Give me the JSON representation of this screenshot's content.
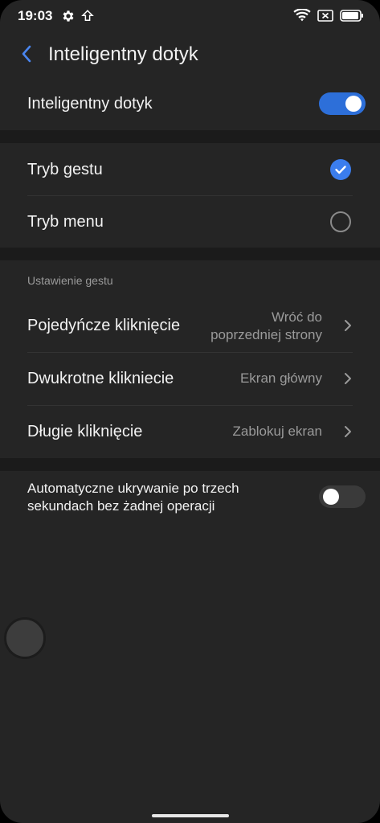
{
  "status_bar": {
    "time": "19:03",
    "icons": [
      "gear-icon",
      "upload-arrow-icon",
      "wifi-icon",
      "no-sim-icon",
      "battery-icon"
    ],
    "battery_level": 0.9
  },
  "header": {
    "back_icon": "chevron-left-icon",
    "title": "Inteligentny dotyk"
  },
  "main_toggle": {
    "label": "Inteligentny dotyk",
    "state": "on"
  },
  "mode": {
    "options": [
      {
        "label": "Tryb gestu",
        "selected": true
      },
      {
        "label": "Tryb menu",
        "selected": false
      }
    ]
  },
  "gesture_settings": {
    "header": "Ustawienie gestu",
    "items": [
      {
        "label": "Pojedyńcze kliknięcie",
        "value_line1": "Wróć do",
        "value_line2": "poprzedniej strony"
      },
      {
        "label": "Dwukrotne klikniecie",
        "value": "Ekran główny"
      },
      {
        "label": "Długie kliknięcie",
        "value": "Zablokuj ekran"
      }
    ]
  },
  "auto_hide": {
    "label_line1": "Automatyczne ukrywanie po trzech",
    "label_line2": "sekundach bez żadnej operacji",
    "state": "off"
  },
  "colors": {
    "accent": "#2d6fd9",
    "background": "#252525",
    "separator": "#1b1b1b"
  }
}
